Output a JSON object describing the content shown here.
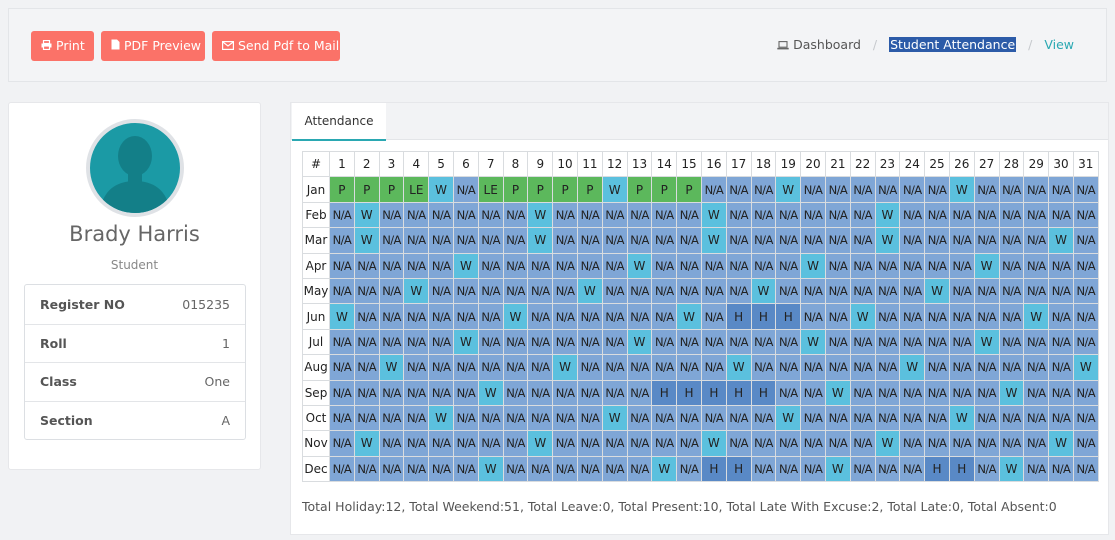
{
  "toolbar": {
    "print_label": "Print",
    "pdf_preview_label": "PDF Preview",
    "send_mail_label": "Send Pdf to Mail"
  },
  "breadcrumb": {
    "dashboard": "Dashboard",
    "current": "Student Attendance",
    "view": "View"
  },
  "profile": {
    "name": "Brady Harris",
    "role": "Student",
    "fields": [
      {
        "label": "Register NO",
        "value": "015235"
      },
      {
        "label": "Roll",
        "value": "1"
      },
      {
        "label": "Class",
        "value": "One"
      },
      {
        "label": "Section",
        "value": "A"
      }
    ]
  },
  "attendance": {
    "tab_label": "Attendance",
    "hash_header": "#",
    "days": [
      "1",
      "2",
      "3",
      "4",
      "5",
      "6",
      "7",
      "8",
      "9",
      "10",
      "11",
      "12",
      "13",
      "14",
      "15",
      "16",
      "17",
      "18",
      "19",
      "20",
      "21",
      "22",
      "23",
      "24",
      "25",
      "26",
      "27",
      "28",
      "29",
      "30",
      "31"
    ],
    "rows": [
      {
        "month": "Jan",
        "cells": [
          "P",
          "P",
          "P",
          "LE",
          "W",
          "N/A",
          "LE",
          "P",
          "P",
          "P",
          "P",
          "W",
          "P",
          "P",
          "P",
          "N/A",
          "N/A",
          "N/A",
          "W",
          "N/A",
          "N/A",
          "N/A",
          "N/A",
          "N/A",
          "N/A",
          "W",
          "N/A",
          "N/A",
          "N/A",
          "N/A",
          "N/A"
        ]
      },
      {
        "month": "Feb",
        "cells": [
          "N/A",
          "W",
          "N/A",
          "N/A",
          "N/A",
          "N/A",
          "N/A",
          "N/A",
          "W",
          "N/A",
          "N/A",
          "N/A",
          "N/A",
          "N/A",
          "N/A",
          "W",
          "N/A",
          "N/A",
          "N/A",
          "N/A",
          "N/A",
          "N/A",
          "W",
          "N/A",
          "N/A",
          "N/A",
          "N/A",
          "N/A",
          "N/A",
          "N/A",
          "N/A"
        ]
      },
      {
        "month": "Mar",
        "cells": [
          "N/A",
          "W",
          "N/A",
          "N/A",
          "N/A",
          "N/A",
          "N/A",
          "N/A",
          "W",
          "N/A",
          "N/A",
          "N/A",
          "N/A",
          "N/A",
          "N/A",
          "W",
          "N/A",
          "N/A",
          "N/A",
          "N/A",
          "N/A",
          "N/A",
          "W",
          "N/A",
          "N/A",
          "N/A",
          "N/A",
          "N/A",
          "N/A",
          "W",
          "N/A"
        ]
      },
      {
        "month": "Apr",
        "cells": [
          "N/A",
          "N/A",
          "N/A",
          "N/A",
          "N/A",
          "W",
          "N/A",
          "N/A",
          "N/A",
          "N/A",
          "N/A",
          "N/A",
          "W",
          "N/A",
          "N/A",
          "N/A",
          "N/A",
          "N/A",
          "N/A",
          "W",
          "N/A",
          "N/A",
          "N/A",
          "N/A",
          "N/A",
          "N/A",
          "W",
          "N/A",
          "N/A",
          "N/A",
          "N/A"
        ]
      },
      {
        "month": "May",
        "cells": [
          "N/A",
          "N/A",
          "N/A",
          "W",
          "N/A",
          "N/A",
          "N/A",
          "N/A",
          "N/A",
          "N/A",
          "W",
          "N/A",
          "N/A",
          "N/A",
          "N/A",
          "N/A",
          "N/A",
          "W",
          "N/A",
          "N/A",
          "N/A",
          "N/A",
          "N/A",
          "N/A",
          "W",
          "N/A",
          "N/A",
          "N/A",
          "N/A",
          "N/A",
          "N/A"
        ]
      },
      {
        "month": "Jun",
        "cells": [
          "W",
          "N/A",
          "N/A",
          "N/A",
          "N/A",
          "N/A",
          "N/A",
          "W",
          "N/A",
          "N/A",
          "N/A",
          "N/A",
          "N/A",
          "N/A",
          "W",
          "N/A",
          "H",
          "H",
          "H",
          "N/A",
          "N/A",
          "W",
          "N/A",
          "N/A",
          "N/A",
          "N/A",
          "N/A",
          "N/A",
          "W",
          "N/A",
          "N/A"
        ]
      },
      {
        "month": "Jul",
        "cells": [
          "N/A",
          "N/A",
          "N/A",
          "N/A",
          "N/A",
          "W",
          "N/A",
          "N/A",
          "N/A",
          "N/A",
          "N/A",
          "N/A",
          "W",
          "N/A",
          "N/A",
          "N/A",
          "N/A",
          "N/A",
          "N/A",
          "W",
          "N/A",
          "N/A",
          "N/A",
          "N/A",
          "N/A",
          "N/A",
          "W",
          "N/A",
          "N/A",
          "N/A",
          "N/A"
        ]
      },
      {
        "month": "Aug",
        "cells": [
          "N/A",
          "N/A",
          "W",
          "N/A",
          "N/A",
          "N/A",
          "N/A",
          "N/A",
          "N/A",
          "W",
          "N/A",
          "N/A",
          "N/A",
          "N/A",
          "N/A",
          "N/A",
          "W",
          "N/A",
          "N/A",
          "N/A",
          "N/A",
          "N/A",
          "N/A",
          "W",
          "N/A",
          "N/A",
          "N/A",
          "N/A",
          "N/A",
          "N/A",
          "W"
        ]
      },
      {
        "month": "Sep",
        "cells": [
          "N/A",
          "N/A",
          "N/A",
          "N/A",
          "N/A",
          "N/A",
          "W",
          "N/A",
          "N/A",
          "N/A",
          "N/A",
          "N/A",
          "N/A",
          "H",
          "H",
          "H",
          "H",
          "H",
          "N/A",
          "N/A",
          "W",
          "N/A",
          "N/A",
          "N/A",
          "N/A",
          "N/A",
          "N/A",
          "W",
          "N/A",
          "N/A",
          "N/A"
        ]
      },
      {
        "month": "Oct",
        "cells": [
          "N/A",
          "N/A",
          "N/A",
          "N/A",
          "W",
          "N/A",
          "N/A",
          "N/A",
          "N/A",
          "N/A",
          "N/A",
          "W",
          "N/A",
          "N/A",
          "N/A",
          "N/A",
          "N/A",
          "N/A",
          "W",
          "N/A",
          "N/A",
          "N/A",
          "N/A",
          "N/A",
          "N/A",
          "W",
          "N/A",
          "N/A",
          "N/A",
          "N/A",
          "N/A"
        ]
      },
      {
        "month": "Nov",
        "cells": [
          "N/A",
          "W",
          "N/A",
          "N/A",
          "N/A",
          "N/A",
          "N/A",
          "N/A",
          "W",
          "N/A",
          "N/A",
          "N/A",
          "N/A",
          "N/A",
          "N/A",
          "W",
          "N/A",
          "N/A",
          "N/A",
          "N/A",
          "N/A",
          "N/A",
          "W",
          "N/A",
          "N/A",
          "N/A",
          "N/A",
          "N/A",
          "N/A",
          "W",
          "N/A"
        ]
      },
      {
        "month": "Dec",
        "cells": [
          "N/A",
          "N/A",
          "N/A",
          "N/A",
          "N/A",
          "N/A",
          "W",
          "N/A",
          "N/A",
          "N/A",
          "N/A",
          "N/A",
          "N/A",
          "W",
          "N/A",
          "H",
          "H",
          "N/A",
          "N/A",
          "N/A",
          "W",
          "N/A",
          "N/A",
          "N/A",
          "H",
          "H",
          "N/A",
          "W",
          "N/A",
          "N/A",
          "N/A"
        ]
      }
    ],
    "colors": {
      "P": "#5cb85c",
      "LE": "#5cb85c",
      "W": "#5bc0de",
      "N/A": "#7fa6d6",
      "H": "#5989c6"
    },
    "summary": "Total Holiday:12, Total Weekend:51, Total Leave:0, Total Present:10, Total Late With Excuse:2, Total Late:0, Total Absent:0"
  }
}
